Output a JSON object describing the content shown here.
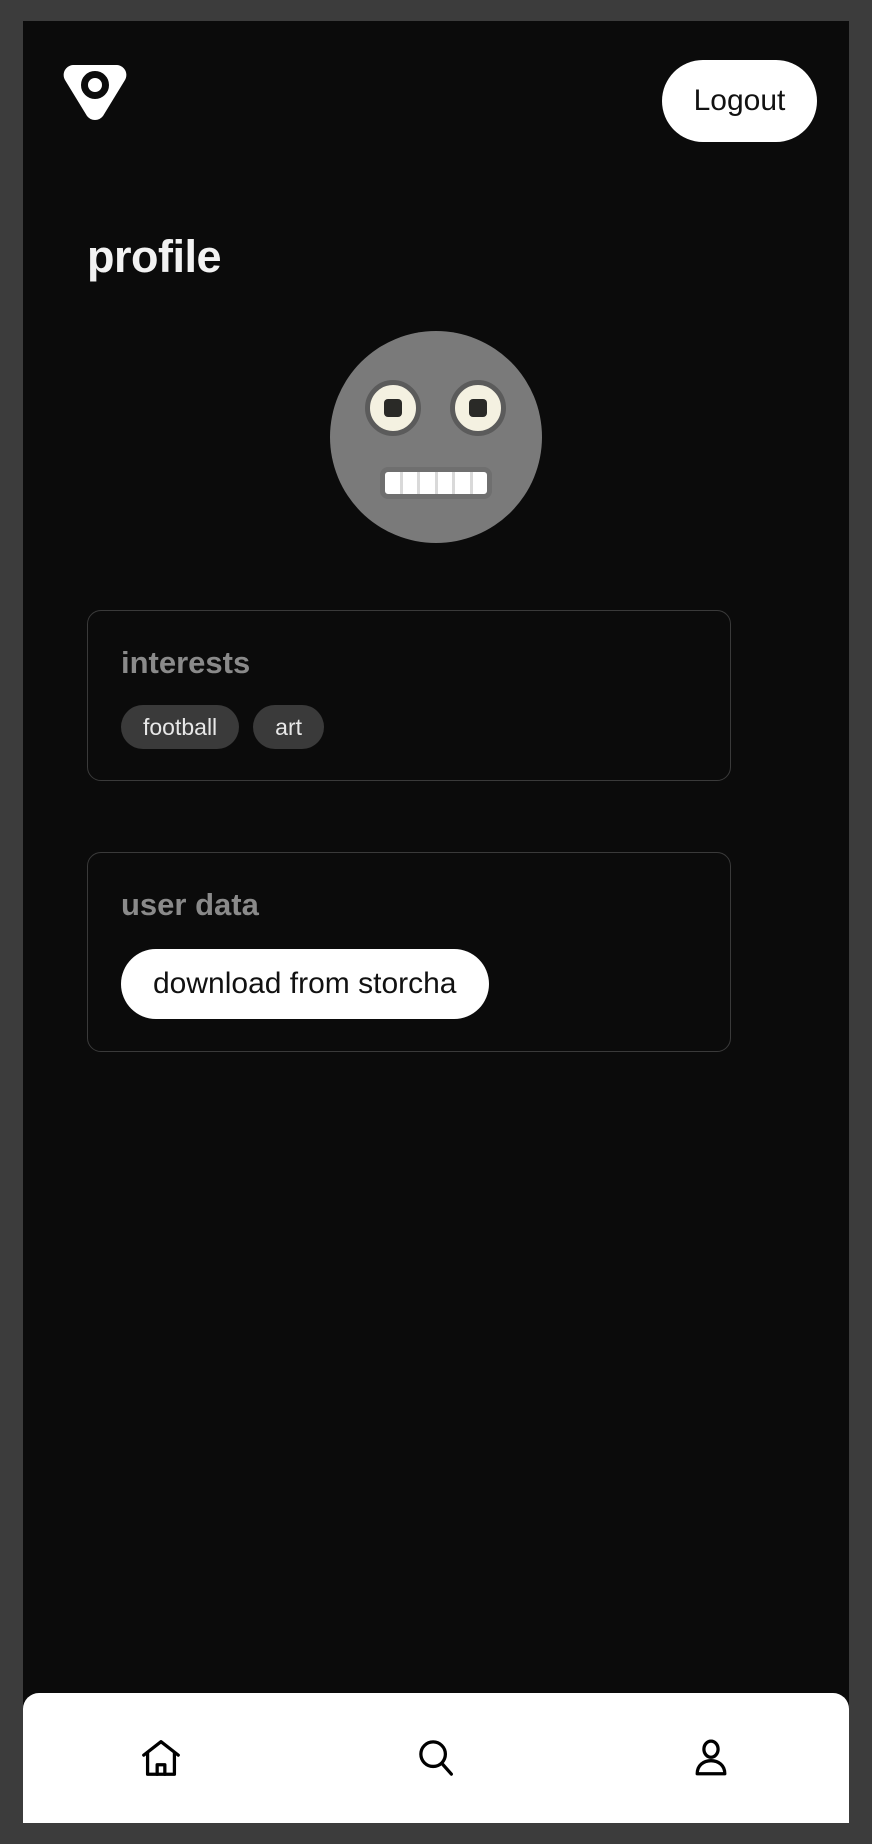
{
  "app": {
    "logo_icon": "triangle-ring-logo-icon",
    "frame_color": "#3c3c3c",
    "screen_background": "#0b0b0b"
  },
  "header": {
    "logout_label": "Logout",
    "logout_bg": "#ffffff",
    "logout_text_color": "#111111"
  },
  "main": {
    "page_title": "profile"
  },
  "avatar": {
    "name": "robot-face-avatar",
    "face_color": "#7a7a7a",
    "eye_color": "#f4f1e1",
    "eye_ring_color": "#5b5b5b",
    "pupil_color": "#2a2a27",
    "mouth_color": "#ffffff",
    "mouth_border_color": "#6f6f6f",
    "teeth_count": 6
  },
  "interests_card": {
    "heading": "interests",
    "heading_color": "#8a8a8a",
    "border_color": "#3a3a3a",
    "tags": [
      {
        "label": "football"
      },
      {
        "label": "art"
      }
    ],
    "tag_bg": "#3a3a3a",
    "tag_text_color": "#e8e8e8"
  },
  "user_data_card": {
    "heading": "user data",
    "heading_color": "#8a8a8a",
    "border_color": "#3a3a3a",
    "download_label": "download from storcha",
    "download_bg": "#ffffff",
    "download_text_color": "#111111"
  },
  "bottom_nav": {
    "background": "#ffffff",
    "icon_color": "#000000",
    "items": [
      {
        "icon": "home-icon",
        "name": "home"
      },
      {
        "icon": "search-icon",
        "name": "search"
      },
      {
        "icon": "person-icon",
        "name": "profile"
      }
    ]
  }
}
